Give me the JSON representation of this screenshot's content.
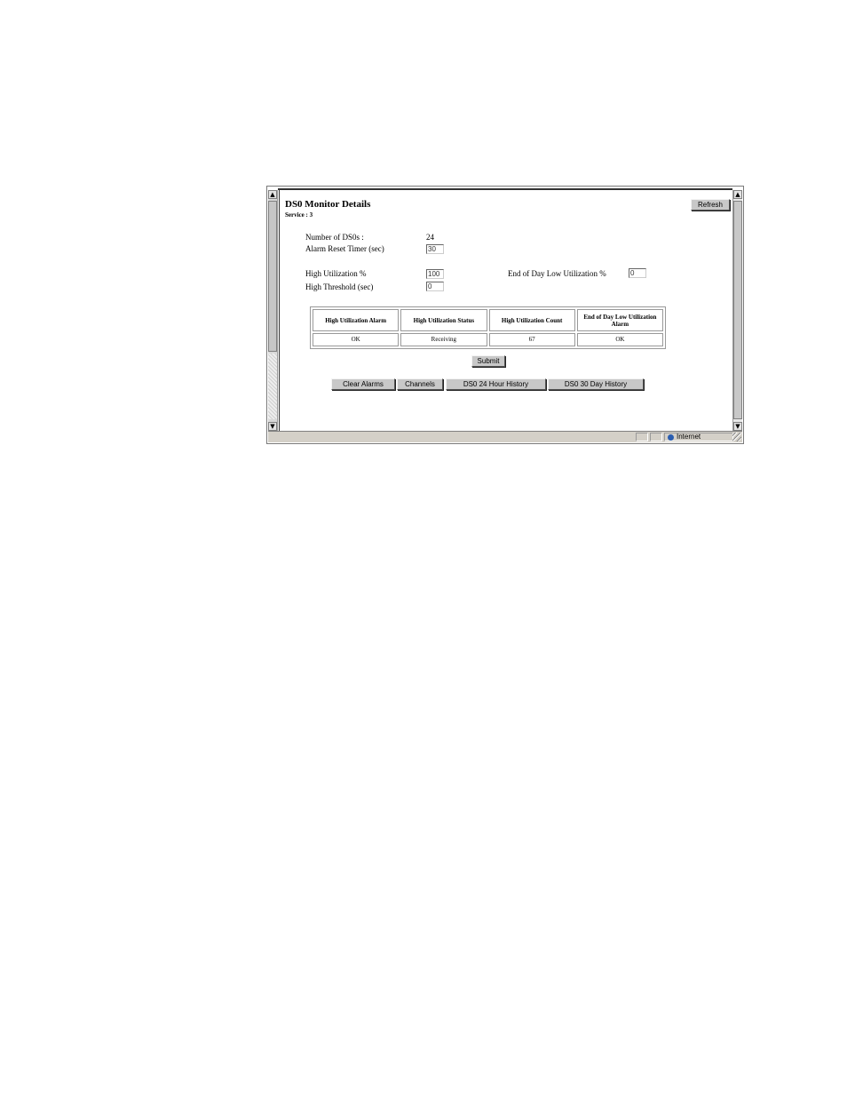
{
  "page": {
    "title": "DS0 Monitor Details",
    "subtitle": "Service : 3",
    "refresh_label": "Refresh"
  },
  "settings": {
    "num_ds0s_label": "Number of DS0s :",
    "num_ds0s_value": "24",
    "alarm_reset_label": "Alarm Reset Timer (sec)",
    "alarm_reset_value": "30",
    "high_util_label": "High Utilization %",
    "high_util_value": "100",
    "eod_low_util_label": "End of Day Low Utilization %",
    "eod_low_util_value": "0",
    "high_threshold_label": "High Threshold (sec)",
    "high_threshold_value": "0"
  },
  "status_table": {
    "headers": [
      "High Utilization Alarm",
      "High Utilization Status",
      "High Utilization Count",
      "End of Day Low Utilization Alarm"
    ],
    "row": [
      "OK",
      "Receiving",
      "67",
      "OK"
    ]
  },
  "actions": {
    "submit_label": "Submit",
    "clear_alarms_label": "Clear Alarms",
    "channels_label": "Channels",
    "history_24h_label": "DS0 24 Hour History",
    "history_30d_label": "DS0 30 Day History"
  },
  "statusbar": {
    "zone": "Internet"
  },
  "icons": {
    "scroll_up": "▲",
    "scroll_down": "▼",
    "zone_icon": "globe-icon"
  }
}
